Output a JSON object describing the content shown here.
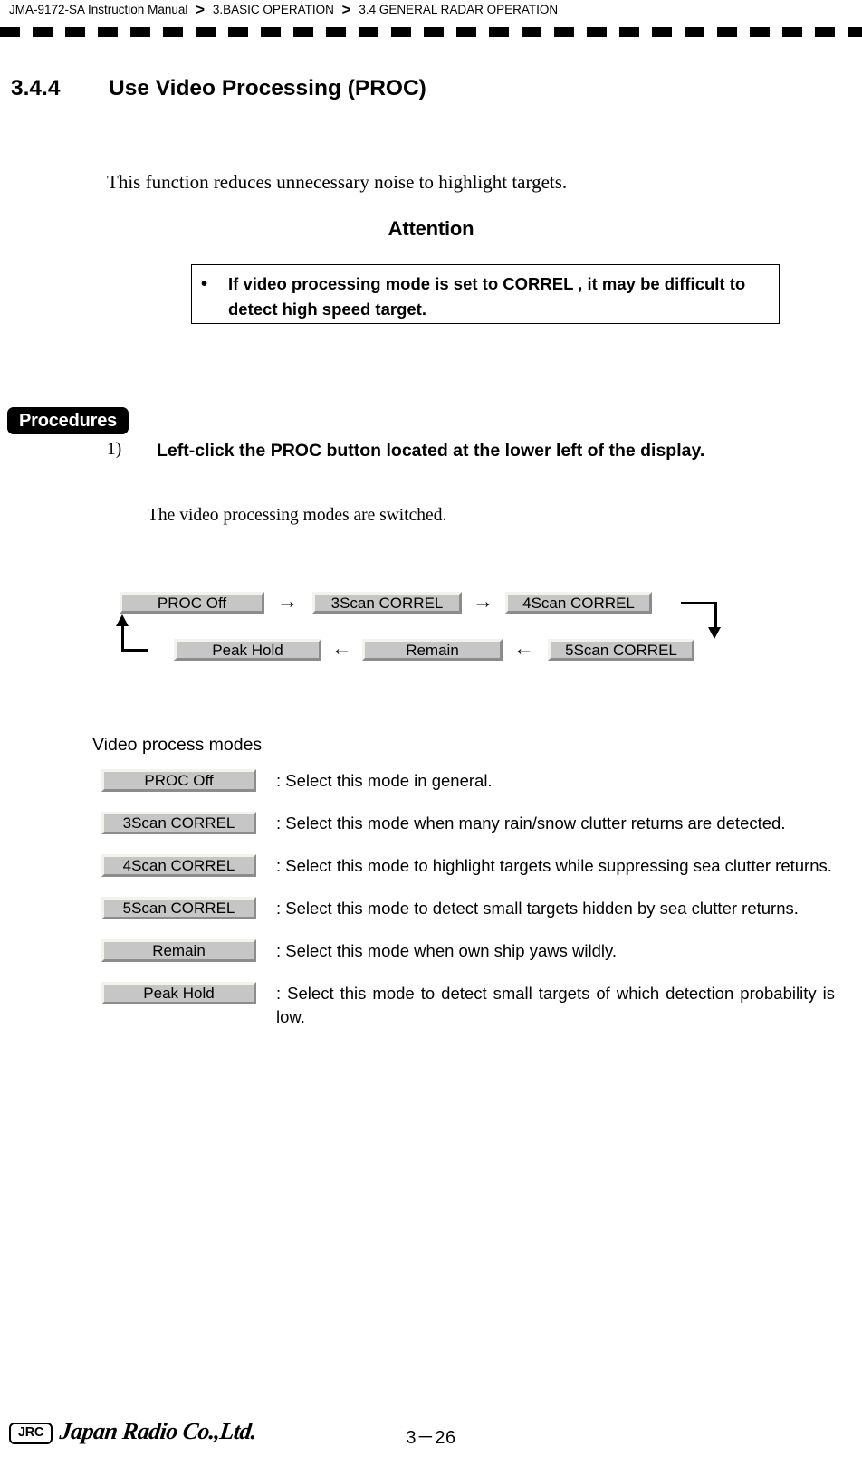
{
  "header": {
    "manual": "JMA-9172-SA Instruction Manual",
    "separator": ">",
    "chapter": "3.BASIC OPERATION",
    "section": "3.4  GENERAL RADAR OPERATION"
  },
  "section": {
    "number": "3.4.4",
    "title": "Use Video Processing (PROC)"
  },
  "intro": "This function reduces unnecessary noise to highlight targets.",
  "attention": {
    "title": "Attention",
    "bullet": "•",
    "text": "If video processing mode is set to  CORREL , it may be difficult to detect high speed target."
  },
  "procedures": {
    "tag": "Procedures",
    "steps": [
      {
        "number": "1)",
        "text": "Left-click the  PROC  button located at the lower left of the display.",
        "sub": "The video processing modes are switched."
      }
    ]
  },
  "flow": {
    "row1": [
      {
        "label": "PROC Off"
      },
      {
        "label": "3Scan CORREL"
      },
      {
        "label": "4Scan CORREL"
      }
    ],
    "row2": [
      {
        "label": "Peak Hold"
      },
      {
        "label": "Remain"
      },
      {
        "label": "5Scan CORREL"
      }
    ],
    "arrow_right": "→",
    "arrow_left": "←"
  },
  "modes": {
    "title": "Video process modes",
    "items": [
      {
        "button": "PROC Off",
        "description": ": Select this mode in general."
      },
      {
        "button": "3Scan CORREL",
        "description": ": Select this mode when many rain/snow clutter returns are detected."
      },
      {
        "button": "4Scan CORREL",
        "description": ": Select this mode to highlight targets while suppressing sea clutter returns."
      },
      {
        "button": "5Scan CORREL",
        "description": ": Select this mode to detect small targets hidden by sea clutter returns."
      },
      {
        "button": "Remain",
        "description": ": Select this mode when own ship yaws wildly."
      },
      {
        "button": "Peak Hold",
        "description": ": Select this mode to detect small targets of which detection probability is low."
      }
    ]
  },
  "footer": {
    "logo_mark": "JRC",
    "company": "Japan Radio Co.,Ltd.",
    "page_number": "3－26"
  }
}
